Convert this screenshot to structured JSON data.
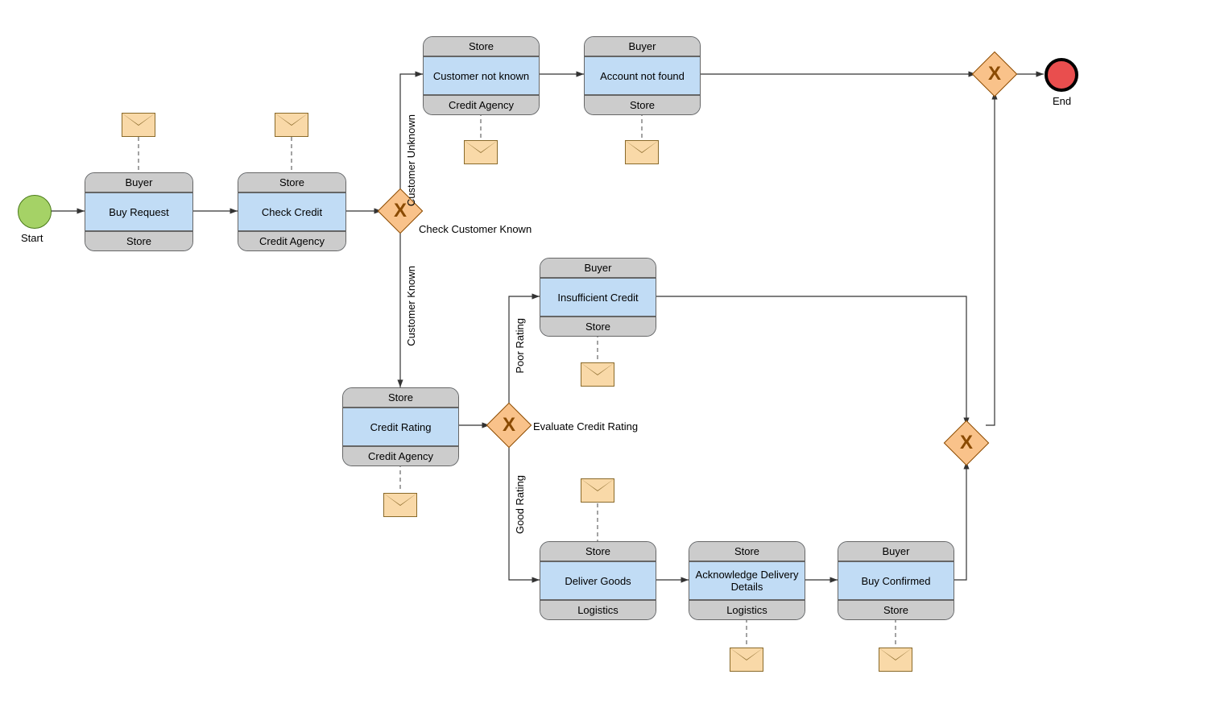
{
  "start_label": "Start",
  "end_label": "End",
  "nodes": {
    "buy_request": {
      "top": "Buyer",
      "mid": "Buy Request",
      "bot": "Store"
    },
    "check_credit": {
      "top": "Store",
      "mid": "Check Credit",
      "bot": "Credit Agency"
    },
    "cust_not_known": {
      "top": "Store",
      "mid": "Customer not known",
      "bot": "Credit Agency"
    },
    "acct_not_found": {
      "top": "Buyer",
      "mid": "Account not found",
      "bot": "Store"
    },
    "credit_rating": {
      "top": "Store",
      "mid": "Credit Rating",
      "bot": "Credit Agency"
    },
    "insuff_credit": {
      "top": "Buyer",
      "mid": "Insufficient Credit",
      "bot": "Store"
    },
    "deliver_goods": {
      "top": "Store",
      "mid": "Deliver Goods",
      "bot": "Logistics"
    },
    "ack_delivery": {
      "top": "Store",
      "mid": "Acknowledge Delivery Details",
      "bot": "Logistics"
    },
    "buy_confirmed": {
      "top": "Buyer",
      "mid": "Buy Confirmed",
      "bot": "Store"
    }
  },
  "gateway_labels": {
    "check_customer": "Check Customer Known",
    "eval_credit": "Evaluate Credit Rating"
  },
  "edge_labels": {
    "cust_unknown": "Customer Unknown",
    "cust_known": "Customer Known",
    "poor_rating": "Poor Rating",
    "good_rating": "Good Rating"
  }
}
